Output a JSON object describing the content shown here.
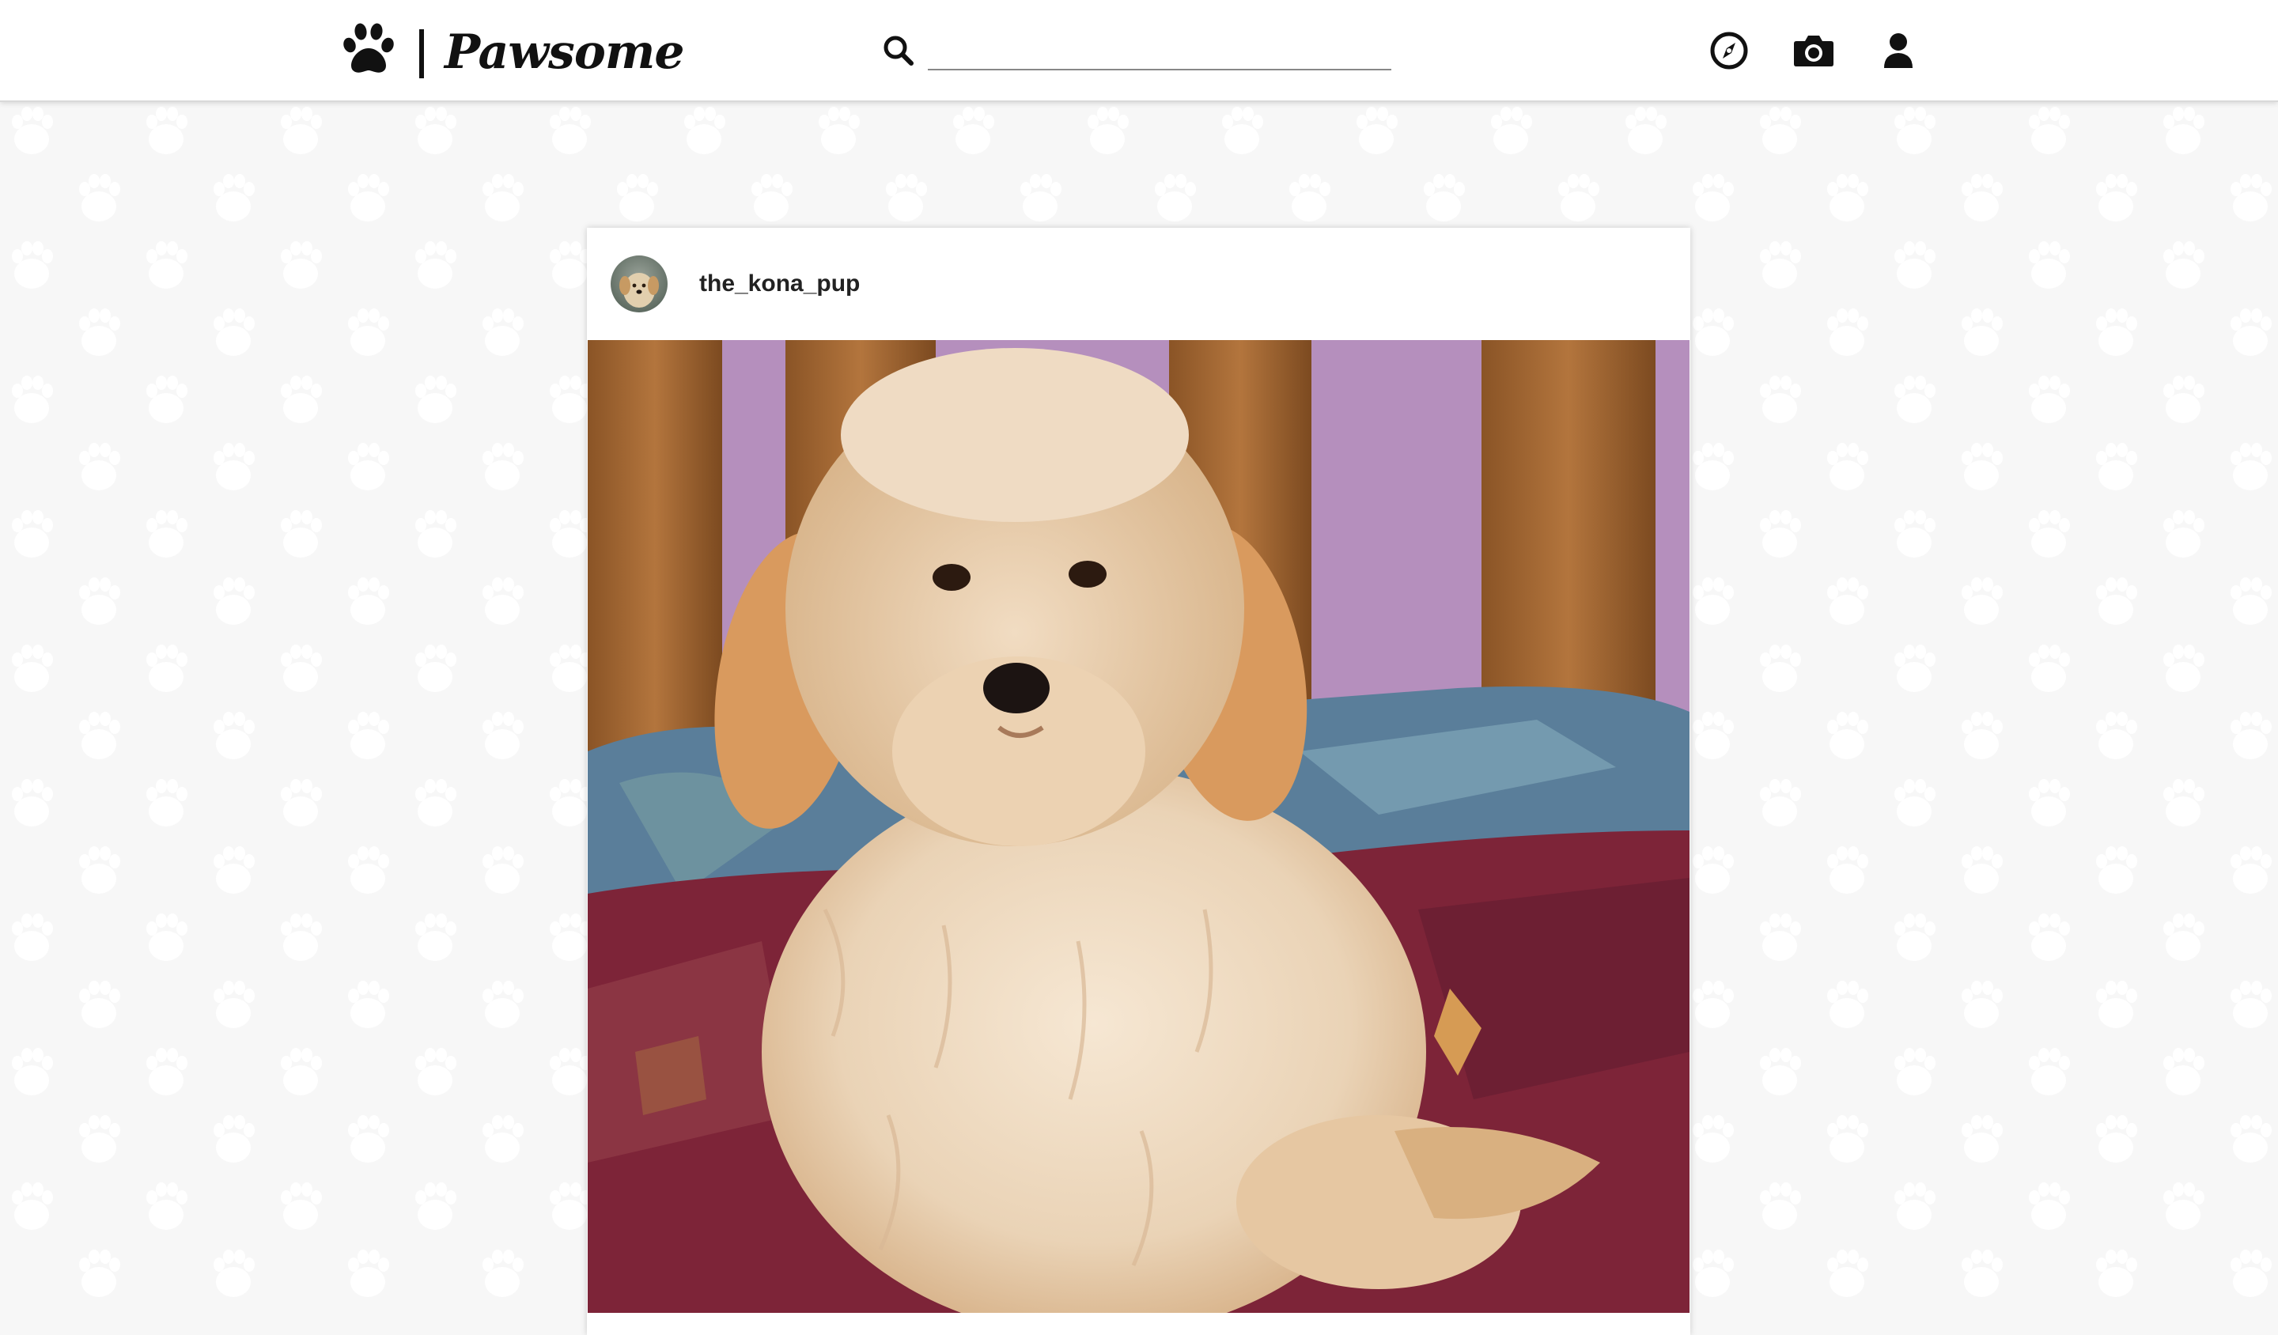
{
  "app": {
    "name": "Pawsome",
    "logo_icon": "paw-icon"
  },
  "search": {
    "icon": "search-icon",
    "value": "",
    "placeholder": ""
  },
  "nav": {
    "items": [
      {
        "name": "explore",
        "icon": "compass-icon"
      },
      {
        "name": "upload",
        "icon": "camera-icon"
      },
      {
        "name": "profile",
        "icon": "user-icon"
      }
    ]
  },
  "post": {
    "username": "the_kona_pup",
    "avatar_icon": "avatar-photo",
    "photo": "photo of a fluffy cream-colored dog sitting on a patterned blanket"
  },
  "colors": {
    "background": "#f7f7f7",
    "header_bg": "#ffffff",
    "text": "#111111"
  }
}
